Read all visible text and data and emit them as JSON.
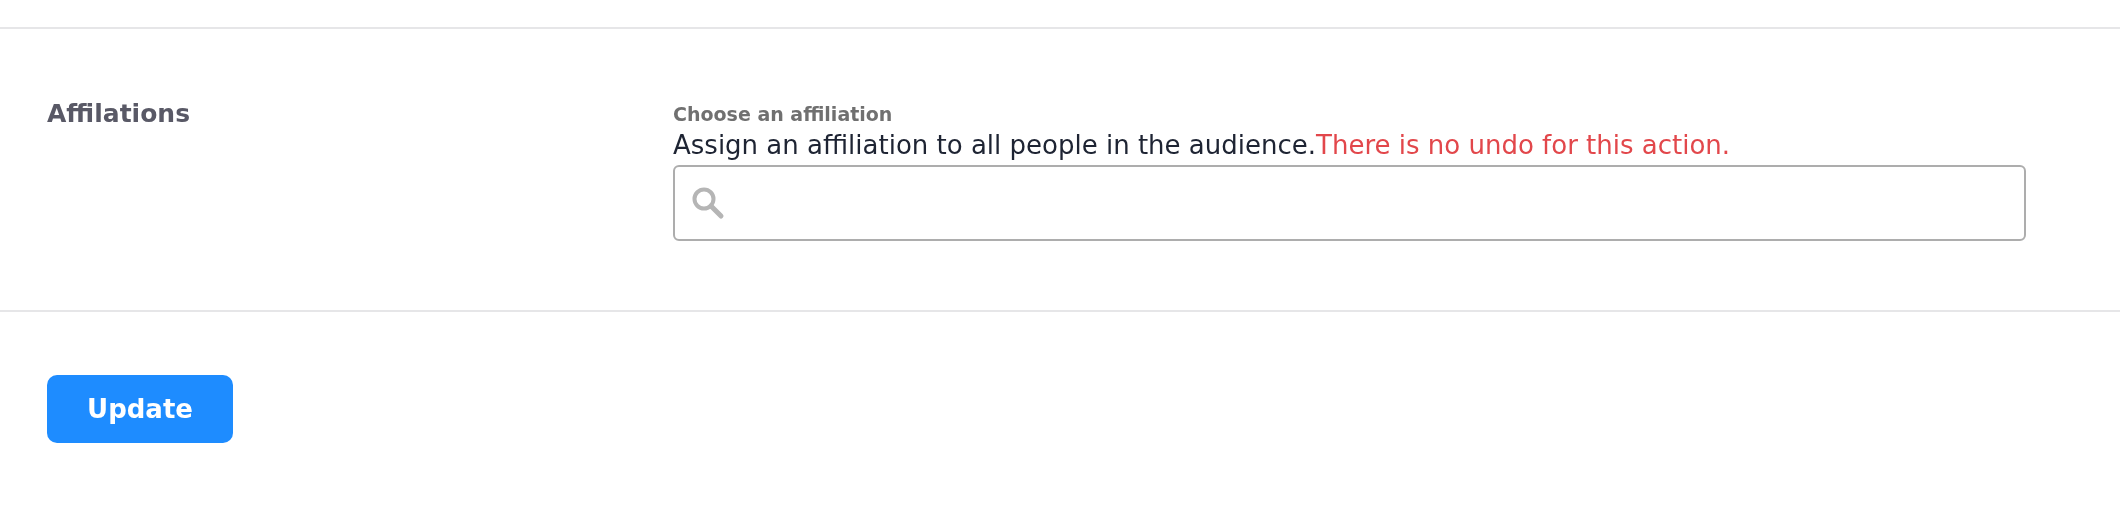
{
  "section": {
    "title": "Affilations",
    "field": {
      "label": "Choose an affiliation",
      "description": "Assign an affiliation to all people in the audience.",
      "warning": "There is no undo for this action."
    }
  },
  "buttons": [
    "Update"
  ]
}
